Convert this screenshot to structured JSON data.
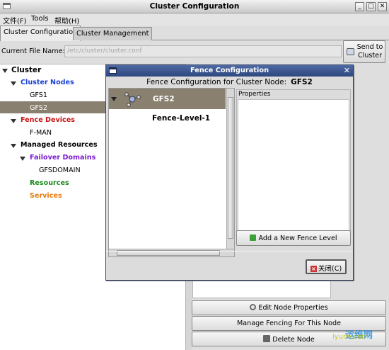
{
  "window": {
    "title": "Cluster Configuration",
    "controls": [
      "_",
      "□",
      "✕"
    ]
  },
  "menu": {
    "items": [
      "文件(F)",
      "Tools",
      "帮助(H)"
    ]
  },
  "tabs": [
    {
      "label": "Cluster Configuration",
      "active": true
    },
    {
      "label": "Cluster Management",
      "active": false
    }
  ],
  "file": {
    "label": "Current File Name:",
    "value": "/etc/cluster/cluster.conf",
    "send_button_line1": "Send to",
    "send_button_line2": "Cluster"
  },
  "tree": {
    "root": "Cluster",
    "cluster_nodes": "Cluster Nodes",
    "nodes": [
      "GFS1",
      "GFS2"
    ],
    "selected_node": "GFS2",
    "fence_devices": "Fence Devices",
    "fence_device_items": [
      "F-MAN"
    ],
    "managed_resources": "Managed Resources",
    "failover_domains": "Failover Domains",
    "failover_domain_items": [
      "GFSDOMAIN"
    ],
    "resources": "Resources",
    "services": "Services",
    "colors": {
      "cluster_nodes": "#1a3fd6",
      "fence_devices": "#c81414",
      "failover_domains": "#7a1ad0",
      "resources": "#1c8a1c",
      "services": "#e8790c",
      "selection": "#8a8070"
    }
  },
  "dialog": {
    "title": "Fence Configuration",
    "heading": "Fence Configuration for Cluster Node:",
    "node": "GFS2",
    "level_node": "GFS2",
    "fence_level": "Fence-Level-1",
    "properties_label": "Properties",
    "add_button": "Add a New Fence Level",
    "close_button": "关闭(C)"
  },
  "actions": {
    "edit_node": "Edit Node Properties",
    "manage_fencing": "Manage Fencing For This Node",
    "delete_node": "Delete Node"
  },
  "watermark": {
    "text": "运维网",
    "subtext": "iyunv.com"
  }
}
